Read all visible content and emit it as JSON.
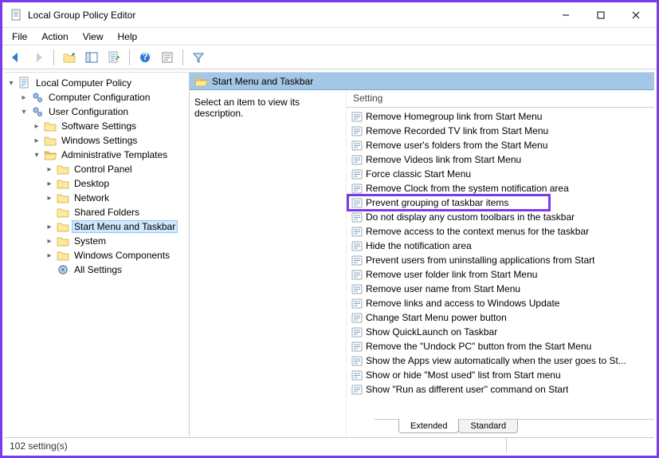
{
  "window": {
    "title": "Local Group Policy Editor"
  },
  "menu": {
    "file": "File",
    "action": "Action",
    "view": "View",
    "help": "Help"
  },
  "tree": {
    "root": "Local Computer Policy",
    "computer_config": "Computer Configuration",
    "user_config": "User Configuration",
    "software_settings": "Software Settings",
    "windows_settings": "Windows Settings",
    "admin_templates": "Administrative Templates",
    "control_panel": "Control Panel",
    "desktop": "Desktop",
    "network": "Network",
    "shared_folders": "Shared Folders",
    "start_menu_taskbar": "Start Menu and Taskbar",
    "system": "System",
    "windows_components": "Windows Components",
    "all_settings": "All Settings"
  },
  "right": {
    "header": "Start Menu and Taskbar",
    "description": "Select an item to view its description.",
    "column": "Setting",
    "settings": [
      "Remove Homegroup link from Start Menu",
      "Remove Recorded TV link from Start Menu",
      "Remove user's folders from the Start Menu",
      "Remove Videos link from Start Menu",
      "Force classic Start Menu",
      "Remove Clock from the system notification area",
      "Prevent grouping of taskbar items",
      "Do not display any custom toolbars in the taskbar",
      "Remove access to the context menus for the taskbar",
      "Hide the notification area",
      "Prevent users from uninstalling applications from Start",
      "Remove user folder link from Start Menu",
      "Remove user name from Start Menu",
      "Remove links and access to Windows Update",
      "Change Start Menu power button",
      "Show QuickLaunch on Taskbar",
      "Remove the \"Undock PC\" button from the Start Menu",
      "Show the Apps view automatically when the user goes to St...",
      "Show or hide \"Most used\" list from Start menu",
      "Show \"Run as different user\" command on Start"
    ],
    "highlight_index": 6
  },
  "tabs": {
    "extended": "Extended",
    "standard": "Standard"
  },
  "status": {
    "count": "102 setting(s)"
  }
}
